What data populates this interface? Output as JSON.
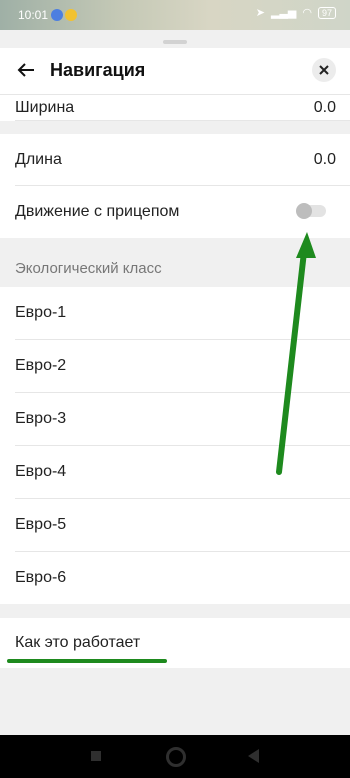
{
  "status_bar": {
    "time": "10:01",
    "battery": "97"
  },
  "header": {
    "title": "Навигация"
  },
  "dimensions": [
    {
      "label": "Ширина",
      "value": "0.0"
    },
    {
      "label": "Длина",
      "value": "0.0"
    }
  ],
  "trailer": {
    "label": "Движение с прицепом",
    "enabled": false
  },
  "eco": {
    "section_title": "Экологический класс",
    "options": [
      "Евро-1",
      "Евро-2",
      "Евро-3",
      "Евро-4",
      "Евро-5",
      "Евро-6"
    ]
  },
  "help": {
    "label": "Как это работает"
  },
  "colors": {
    "annotation": "#1e8a1e",
    "accent_bg": "#f0f0f0"
  }
}
